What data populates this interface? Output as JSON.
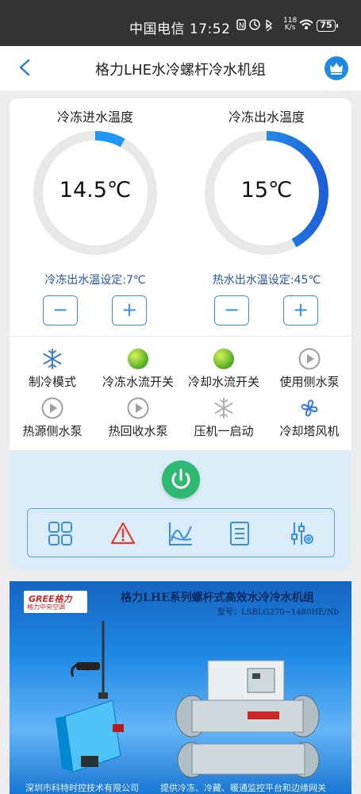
{
  "status_bar": {
    "carrier_time": "中国电信 17:52",
    "net_speed_value": "118",
    "net_speed_unit": "K/s",
    "signal": "46",
    "battery": "75"
  },
  "header": {
    "title": "格力LHE水冷螺杆冷水机组",
    "crown_icon": "crown-icon"
  },
  "gauges": {
    "inlet": {
      "label": "冷冻进水温度",
      "value": "14.5℃",
      "fill": 0.08
    },
    "outlet": {
      "label": "冷冻出水温度",
      "value": "15℃",
      "fill": 0.42
    }
  },
  "setpoints": {
    "chilled": "冷冻出水温设定:7℃",
    "hot": "热水出水温设定:45℃",
    "minus": "−",
    "plus": "+"
  },
  "status_items": [
    {
      "label": "制冷模式",
      "icon": "snowflake-icon",
      "color": "#3a7bd5"
    },
    {
      "label": "冷冻水流开关",
      "icon": "green-light-icon",
      "color": "#4caf20"
    },
    {
      "label": "冷却水流开关",
      "icon": "green-light-icon",
      "color": "#4caf20"
    },
    {
      "label": "使用侧水泵",
      "icon": "pump-play-icon",
      "color": "#9e9e9e"
    },
    {
      "label": "热源侧水泵",
      "icon": "pump-play-icon",
      "color": "#9e9e9e"
    },
    {
      "label": "热回收水泵",
      "icon": "pump-play-icon",
      "color": "#9e9e9e"
    },
    {
      "label": "压机一启动",
      "icon": "snowflake-icon",
      "color": "#b0b0b0"
    },
    {
      "label": "冷却塔风机",
      "icon": "fan-icon",
      "color": "#3a7bd5"
    }
  ],
  "toolbar": [
    "grid-icon",
    "alarm-icon",
    "curve-icon",
    "list-icon",
    "settings-icon"
  ],
  "banner": {
    "logo_text": "GREE格力",
    "logo_sub": "格力中央空调",
    "title": "格力LHE系列螺杆式高效水冷冷水机组",
    "model": "型号：LSBLG270~1480HE/Nb",
    "footer_left": "深圳市科特时控技术有限公司",
    "footer_right": "提供冷冻、冷藏、暖通监控平台和边缘网关"
  },
  "colors": {
    "accent": "#3a8ee6",
    "power": "#2eb872",
    "setpoint_text": "#2255aa"
  }
}
